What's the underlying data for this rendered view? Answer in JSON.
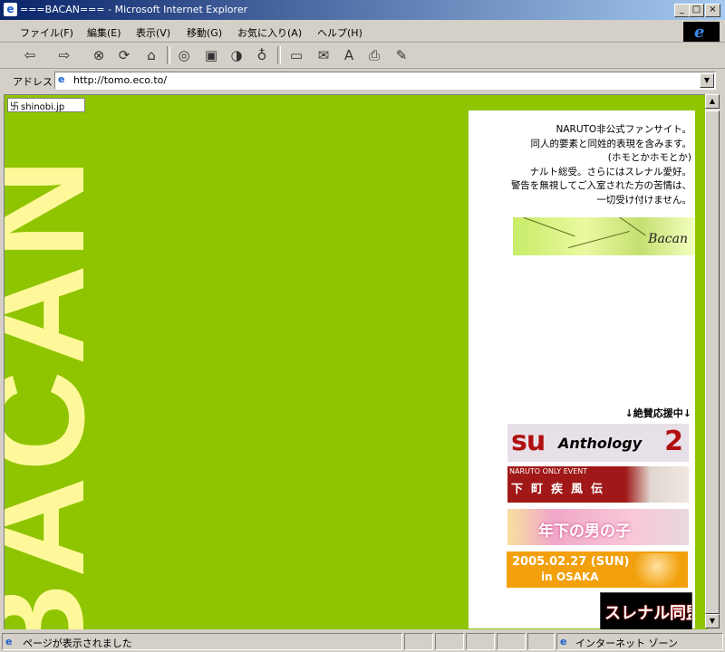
{
  "window": {
    "title": "===BACAN=== - Microsoft Internet Explorer",
    "minimize_glyph": "_",
    "maximize_glyph": "□",
    "close_glyph": "×",
    "app_icon_glyph": "e"
  },
  "menu": {
    "items": [
      {
        "label": "ファイル(F)"
      },
      {
        "label": "編集(E)"
      },
      {
        "label": "表示(V)"
      },
      {
        "label": "移動(G)"
      },
      {
        "label": "お気に入り(A)"
      },
      {
        "label": "ヘルプ(H)"
      }
    ],
    "brand_glyph": "e"
  },
  "toolbar": {
    "back_glyph": "⇦",
    "forward_glyph": "⇨",
    "stop_glyph": "⊗",
    "refresh_glyph": "⟳",
    "home_glyph": "⌂",
    "search_glyph": "◎",
    "favorites_glyph": "▣",
    "history_glyph": "◑",
    "channels_glyph": "♁",
    "fullscreen_glyph": "▭",
    "mail_glyph": "✉",
    "font_glyph": "A",
    "print_glyph": "⎙",
    "edit_glyph": "✎"
  },
  "address": {
    "label": "アドレス",
    "url": "http://tomo.eco.to/",
    "dropdown_glyph": "▼"
  },
  "page": {
    "tab_label": "shinobi.jp",
    "tab_icon_glyph": "卐",
    "big_title": "BACAN",
    "notice_lines": [
      "NARUTO非公式ファンサイト。",
      "同人的要素と同姓的表現を含みます。",
      "(ホモとかホモとか)",
      "ナルト総受。さらにはスレナル愛好。",
      "警告を無視してご入室された方の苦情は、",
      "一切受け付けません。"
    ],
    "bacan_banner_text": "Bacan",
    "support_heading": "↓絶賛応援中↓",
    "banners": {
      "b1_left": "su",
      "b1_mid": "Anthology",
      "b1_right": "2",
      "b2_top": "NARUTO ONLY EVENT",
      "b2_main": "下町疾風伝",
      "b3_text": "年下の男の子",
      "b4_date": "2005.02.27 (SUN)",
      "b4_place": "in OSAKA",
      "b5_text": "スレナル同盟"
    },
    "colors": {
      "background": "#8fc400",
      "title_text": "#fff89a",
      "panel": "#ffffff"
    }
  },
  "scrollbar": {
    "up_glyph": "▲",
    "down_glyph": "▼"
  },
  "status": {
    "message": "ページが表示されました",
    "zone": "インターネット ゾーン",
    "icon_glyph": "e"
  }
}
